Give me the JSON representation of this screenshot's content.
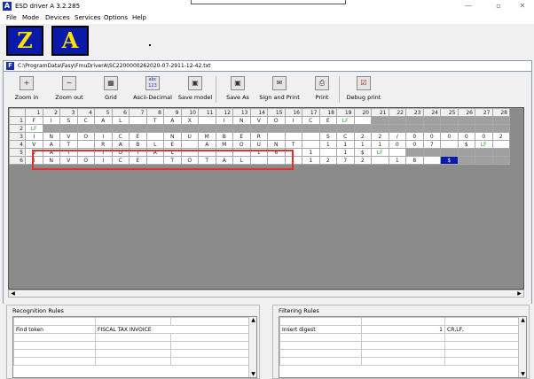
{
  "app": {
    "icon_letter": "A",
    "title": "ESD driver A  3.2.285",
    "controls": {
      "minimize": "—",
      "restore": "▫",
      "close": "✕"
    }
  },
  "menu": [
    "File",
    "Mode",
    "Devices",
    "Services",
    "Options",
    "Help"
  ],
  "mode_buttons": {
    "z": "Z",
    "a": "A"
  },
  "child_window": {
    "icon_letter": "F",
    "path": "C:\\ProgramData\\Fasy\\FmuDriverA\\SC2200000262020-07-2911-12-42.txt"
  },
  "toolbar": [
    {
      "label": "Zoom in",
      "icon": "zoom-in-icon",
      "glyph": "🔍"
    },
    {
      "label": "Zoom out",
      "icon": "zoom-out-icon",
      "glyph": "🔍"
    },
    {
      "label": "Grid",
      "icon": "grid-icon",
      "glyph": "▦"
    },
    {
      "label": "Ascii-Decimal",
      "icon": "ascii-decimal-icon",
      "glyph": "abc"
    },
    {
      "label": "Save model",
      "icon": "save-model-icon",
      "glyph": "💾"
    },
    {
      "label": "Save As",
      "icon": "save-as-icon",
      "glyph": "💾"
    },
    {
      "label": "Sign and Print",
      "icon": "sign-print-icon",
      "glyph": "✉"
    },
    {
      "label": "Print",
      "icon": "print-icon",
      "glyph": "🖶"
    },
    {
      "label": "Debug print",
      "icon": "debug-print-icon",
      "glyph": "☑"
    }
  ],
  "grid": {
    "columns": [
      "1",
      "2",
      "3",
      "4",
      "5",
      "6",
      "7",
      "8",
      "9",
      "10",
      "11",
      "12",
      "13",
      "14",
      "15",
      "16",
      "17",
      "18",
      "19",
      "20",
      "21",
      "22",
      "23",
      "24",
      "25",
      "26",
      "27",
      "28"
    ],
    "rows": [
      {
        "num": "1",
        "cells": [
          "F",
          "I",
          "S",
          "C",
          "A",
          "L",
          "",
          "T",
          "A",
          "X",
          "",
          "I",
          "N",
          "V",
          "O",
          "I",
          "C",
          "E",
          "LF",
          "",
          "",
          "",
          "",
          "",
          "",
          "",
          "",
          ""
        ]
      },
      {
        "num": "2",
        "cells": [
          "LF",
          "",
          "",
          "",
          "",
          "",
          "",
          "",
          "",
          "",
          "",
          "",
          "",
          "",
          "",
          "",
          "",
          "",
          "",
          "",
          "",
          "",
          "",
          "",
          "",
          "",
          "",
          ""
        ]
      },
      {
        "num": "3",
        "cells": [
          "I",
          "N",
          "V",
          "O",
          "I",
          "C",
          "E",
          "",
          "N",
          "U",
          "M",
          "B",
          "E",
          "R",
          "",
          "",
          "",
          "S",
          "C",
          "2",
          "2",
          "/",
          "0",
          "0",
          "0",
          "0",
          "0",
          "2"
        ]
      },
      {
        "num": "4",
        "cells": [
          "V",
          "A",
          "T",
          "",
          "R",
          "A",
          "B",
          "L",
          "E",
          "",
          "A",
          "M",
          "O",
          "U",
          "N",
          "T",
          "",
          "1",
          "1",
          "1",
          "1",
          "0",
          "0",
          "7",
          "",
          "$",
          "LF",
          ""
        ]
      },
      {
        "num": "5",
        "cells": [
          "V",
          "A",
          "T",
          "",
          "T",
          "O",
          "T",
          "A",
          "L",
          "",
          "",
          "",
          "",
          "1",
          "6",
          "",
          "1",
          "",
          "1",
          "$",
          "LF",
          "",
          "",
          "",
          "",
          "",
          "",
          ""
        ]
      },
      {
        "num": "6",
        "cells": [
          "I",
          "N",
          "V",
          "O",
          "I",
          "C",
          "E",
          "",
          "T",
          "O",
          "T",
          "A",
          "L",
          "",
          "",
          "",
          "1",
          "2",
          "7",
          "2",
          "",
          "1",
          "8",
          "",
          "$",
          "",
          "",
          ""
        ]
      }
    ]
  },
  "recognition_rules": {
    "title": "Recognition Rules",
    "rows": [
      {
        "name": "Find token",
        "value": "FISCAL TAX INVOICE"
      }
    ]
  },
  "filtering_rules": {
    "title": "Filtering Rules",
    "rows": [
      {
        "name": "Insert digest",
        "num": "1",
        "value": "CR,LF,"
      }
    ]
  }
}
